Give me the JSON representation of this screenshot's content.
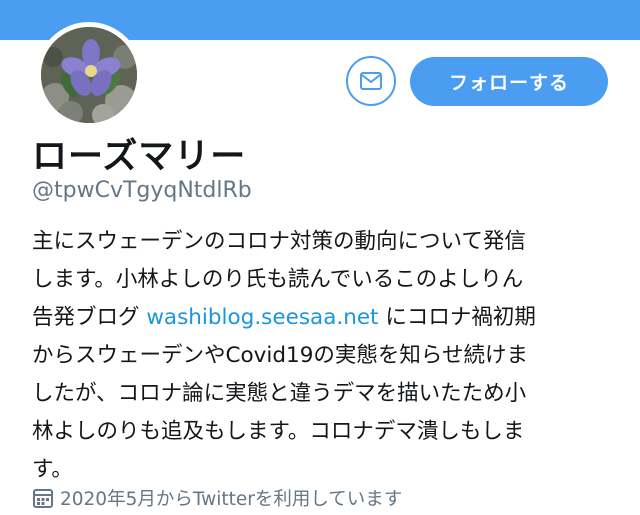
{
  "colors": {
    "accent": "#4a9df1",
    "link": "#1b95e0",
    "text_primary": "#14171a",
    "text_secondary": "#657786"
  },
  "header": {
    "message_icon": "envelope-icon",
    "follow_label": "フォローする"
  },
  "profile": {
    "display_name": "ローズマリー",
    "handle": "@tpwCvTgyqNtdlRb",
    "avatar": "flower-photo"
  },
  "bio": {
    "line1": "主にスウェーデンのコロナ対策の動向について発信",
    "line2": "します。小林よしのり氏も読んでいるこのよしりん",
    "line3_pre": "告発ブログ ",
    "line3_link": "washiblog.seesaa.net",
    "line3_post": " にコロナ禍初期",
    "line4": "からスウェーデンやCovid19の実態を知らせ続けま",
    "line5": "したが、コロナ論に実態と違うデマを描いたため小",
    "line6": "林よしのりも追及もします。コロナデマ潰しもしま",
    "line7": "す。"
  },
  "joined": {
    "icon": "calendar-icon",
    "text": "2020年5月からTwitterを利用しています"
  }
}
